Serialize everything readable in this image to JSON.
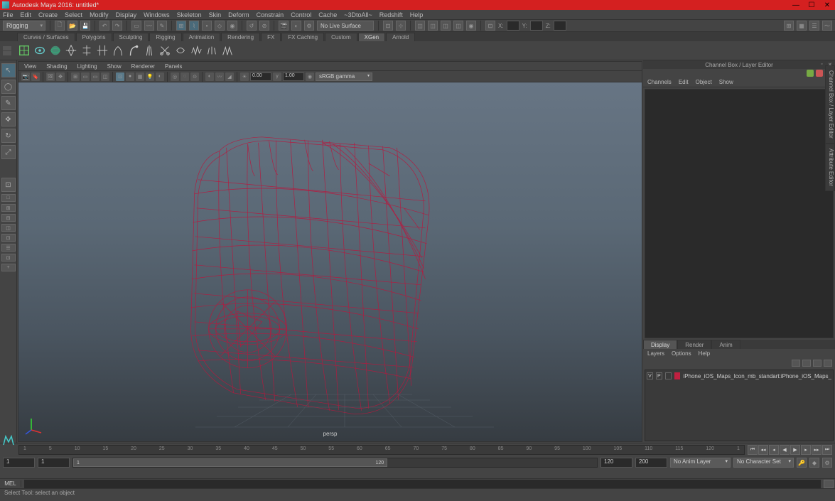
{
  "title": "Autodesk Maya 2016: untitled*",
  "main_menu": [
    "File",
    "Edit",
    "Create",
    "Select",
    "Modify",
    "Display",
    "Windows",
    "Skeleton",
    "Skin",
    "Deform",
    "Constrain",
    "Control",
    "Cache",
    "~3DtoAll~",
    "Redshift",
    "Help"
  ],
  "module_dropdown": "Rigging",
  "snap_status": "No Live Surface",
  "coord_labels": {
    "x": "X:",
    "y": "Y:",
    "z": "Z:"
  },
  "shelf_tabs": [
    "Curves / Surfaces",
    "Polygons",
    "Sculpting",
    "Rigging",
    "Animation",
    "Rendering",
    "FX",
    "FX Caching",
    "Custom",
    "XGen",
    "Arnold"
  ],
  "active_shelf_tab": "XGen",
  "viewport_menu": [
    "View",
    "Shading",
    "Lighting",
    "Show",
    "Renderer",
    "Panels"
  ],
  "vp_exposure": "0.00",
  "vp_gamma": "1.00",
  "colorspace": "sRGB gamma",
  "camera_name": "persp",
  "channel_box": {
    "title": "Channel Box / Layer Editor",
    "menu": [
      "Channels",
      "Edit",
      "Object",
      "Show"
    ]
  },
  "layer_editor": {
    "tabs": [
      "Display",
      "Render",
      "Anim"
    ],
    "active": "Display",
    "menu": [
      "Layers",
      "Options",
      "Help"
    ],
    "layer_vis": "V",
    "layer_play": "P",
    "layer_name": "iPhone_iOS_Maps_Icon_mb_standart:iPhone_iOS_Maps_"
  },
  "right_tabs": [
    "Channel Box / Layer Editor",
    "Attribute Editor"
  ],
  "timeline": {
    "ticks": [
      "1",
      "5",
      "10",
      "15",
      "20",
      "25",
      "30",
      "35",
      "40",
      "45",
      "50",
      "55",
      "60",
      "65",
      "70",
      "75",
      "80",
      "85",
      "90",
      "95",
      "100",
      "105",
      "110",
      "115",
      "120",
      "1"
    ],
    "range_start": "1",
    "range_end": "120",
    "range_min": "1",
    "range_max": "200",
    "thumb_start": "1",
    "thumb_end": "120",
    "anim_layer": "No Anim Layer",
    "char_set": "No Character Set"
  },
  "cmd_label": "MEL",
  "help_text": "Select Tool: select an object"
}
